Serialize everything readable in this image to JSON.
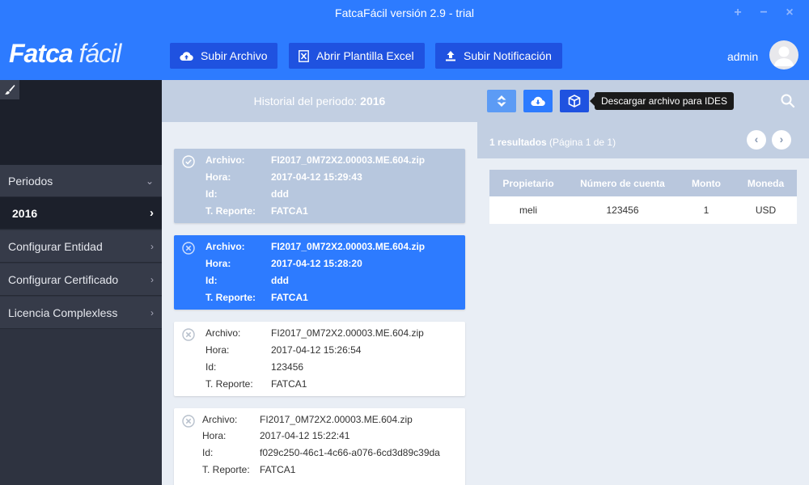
{
  "window": {
    "title": "FatcaFácil versión 2.9 - trial",
    "controls": [
      "+",
      "−",
      "×"
    ]
  },
  "header": {
    "logo_part1": "Fatca",
    "logo_part2": "fácil",
    "buttons": {
      "upload": "Subir Archivo",
      "excel": "Abrir Plantilla Excel",
      "notification": "Subir Notificación"
    },
    "user": "admin"
  },
  "sidebar": {
    "items": [
      {
        "label": "Periodos",
        "chev": "⌄"
      },
      {
        "label": "2016",
        "chev": "›"
      },
      {
        "label": "Configurar Entidad",
        "chev": "›"
      },
      {
        "label": "Configurar Certificado",
        "chev": "›"
      },
      {
        "label": "Licencia Complexless",
        "chev": "›"
      }
    ]
  },
  "history": {
    "title_prefix": "Historial del periodo:",
    "title_year": "2016",
    "labels": {
      "archivo": "Archivo:",
      "hora": "Hora:",
      "id": "Id:",
      "reporte": "T. Reporte:"
    },
    "cards": [
      {
        "archivo": "FI2017_0M72X2.00003.ME.604.zip",
        "hora": "2017-04-12 15:29:43",
        "id": "ddd",
        "reporte": "FATCA1",
        "status": "ok"
      },
      {
        "archivo": "FI2017_0M72X2.00003.ME.604.zip",
        "hora": "2017-04-12 15:28:20",
        "id": "ddd",
        "reporte": "FATCA1",
        "status": "error"
      },
      {
        "archivo": "FI2017_0M72X2.00003.ME.604.zip",
        "hora": "2017-04-12 15:26:54",
        "id": "123456",
        "reporte": "FATCA1",
        "status": "error"
      },
      {
        "archivo": "FI2017_0M72X2.00003.ME.604.zip",
        "hora": "2017-04-12 15:22:41",
        "id": "f029c250-46c1-4c66-a076-6cd3d89c39da",
        "reporte": "FATCA1",
        "status": "error"
      }
    ]
  },
  "results": {
    "tooltip": "Descargar archivo para IDES",
    "count_text": "1 resultados",
    "page_text": "(Página 1 de 1)",
    "prev": "‹",
    "next": "›",
    "table": {
      "headers": [
        "Propietario",
        "Número de cuenta",
        "Monto",
        "Moneda"
      ],
      "rows": [
        [
          "meli",
          "123456",
          "1",
          "USD"
        ]
      ]
    }
  }
}
